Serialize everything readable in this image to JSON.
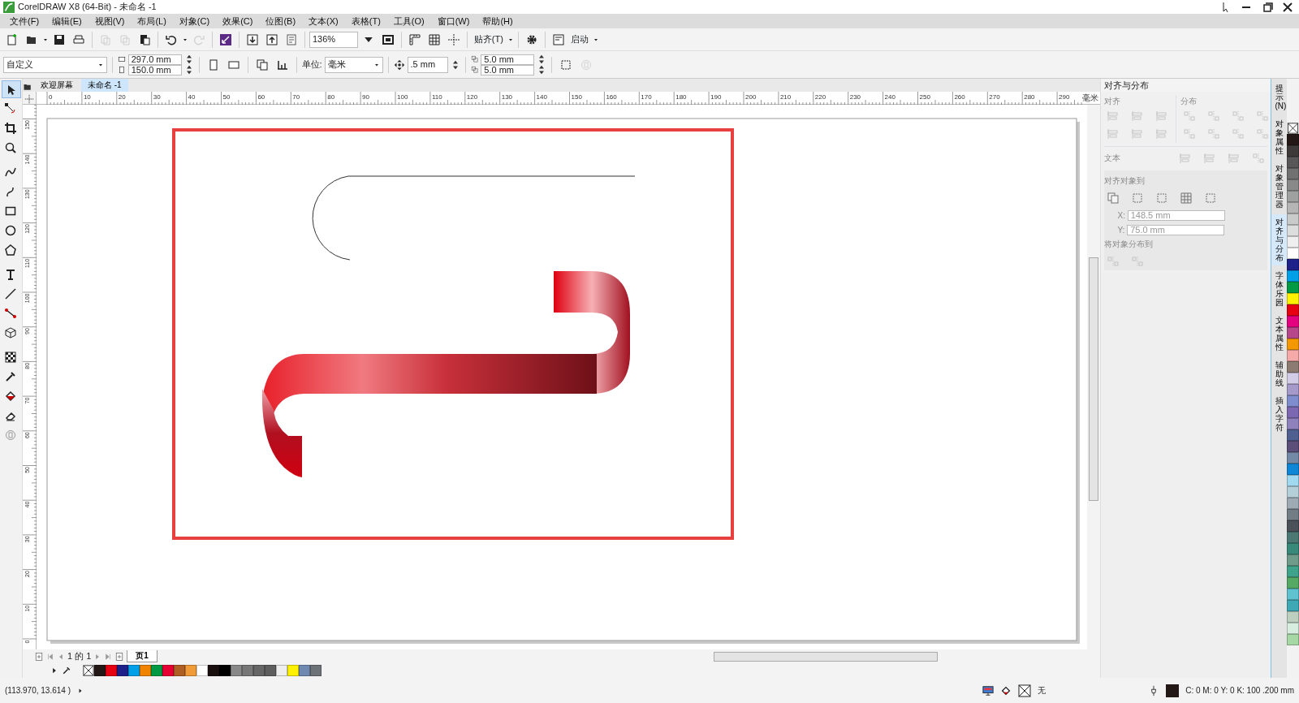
{
  "window": {
    "title": "CorelDRAW X8 (64-Bit) - 未命名 -1"
  },
  "menu": [
    "文件(F)",
    "编辑(E)",
    "视图(V)",
    "布局(L)",
    "对象(C)",
    "效果(C)",
    "位图(B)",
    "文本(X)",
    "表格(T)",
    "工具(O)",
    "窗口(W)",
    "帮助(H)"
  ],
  "standard_toolbar": {
    "buttons": [
      {
        "disabled": false
      },
      {
        "disabled": false
      },
      {
        "disabled": false
      },
      {
        "disabled": false
      },
      {
        "disabled": true
      },
      {
        "disabled": true
      },
      {
        "disabled": false
      },
      {
        "disabled": false
      },
      {
        "disabled": true
      },
      {
        "disabled": false
      },
      {
        "disabled": false
      },
      {
        "disabled": false
      },
      {
        "disabled": false
      }
    ],
    "zoom": "136%",
    "snap_label": "贴齐(T)",
    "launch_label": "启动"
  },
  "property_bar": {
    "preset": "自定义",
    "width": "297.0 mm",
    "height": "150.0 mm",
    "units_label": "单位:",
    "units": "毫米",
    "nudge": ".5 mm",
    "dup_x": "5.0 mm",
    "dup_y": "5.0 mm"
  },
  "toolbox": [
    {
      "selected": true
    },
    {
      "selected": false
    },
    {
      "selected": false
    },
    {
      "selected": false
    },
    {
      "selected": false
    },
    {
      "selected": false
    },
    {
      "selected": false
    },
    {
      "selected": false
    },
    {
      "selected": false
    },
    {
      "selected": false
    },
    {
      "selected": false
    },
    {
      "selected": false
    },
    {
      "selected": false
    },
    {
      "selected": false
    },
    {
      "selected": false
    },
    {
      "selected": false
    },
    {
      "selected": false
    },
    {
      "selected": false
    }
  ],
  "doc_tabs": [
    {
      "label": "欢迎屏幕",
      "selected": false
    },
    {
      "label": "未命名 -1",
      "selected": true
    }
  ],
  "top_ruler": [
    "0",
    "10",
    "20",
    "30",
    "40",
    "50",
    "60",
    "70",
    "80",
    "90",
    "100",
    "110",
    "120",
    "130",
    "140",
    "150",
    "160",
    "170",
    "180",
    "190",
    "200",
    "210",
    "220",
    "230",
    "240",
    "250",
    "260",
    "270",
    "280",
    "290"
  ],
  "ruler_unit": "毫米",
  "left_ruler": [
    "150",
    "140",
    "130",
    "120",
    "110",
    "100",
    "90",
    "80",
    "70",
    "60",
    "50",
    "40",
    "30",
    "20",
    "10",
    "0"
  ],
  "docker": {
    "title": "对齐与分布",
    "align_label": "对齐",
    "distribute_label": "分布",
    "text_label": "文本",
    "align_to_label": "对齐对象到",
    "x_label": "X:",
    "x": "148.5 mm",
    "y_label": "Y:",
    "y": "75.0 mm",
    "distribute_to_label": "将对象分布到"
  },
  "docker_tabs": [
    {
      "label": "提示(N)",
      "selected": false
    },
    {
      "label": "对象属性",
      "selected": false
    },
    {
      "label": "对象管理器",
      "selected": false
    },
    {
      "label": "对齐与分布",
      "selected": true
    },
    {
      "label": "字体乐园",
      "selected": false
    },
    {
      "label": "文本属性",
      "selected": false
    },
    {
      "label": "辅助线",
      "selected": false
    },
    {
      "label": "插入字符",
      "selected": false
    }
  ],
  "page_nav": {
    "counter": "1 的 1",
    "page_tabs": [
      {
        "label": "页1",
        "selected": true
      }
    ]
  },
  "bottom_palette": [
    {
      "color": "#231815"
    },
    {
      "color": "#e60012"
    },
    {
      "color": "#1d2088"
    },
    {
      "color": "#00a0e9"
    },
    {
      "color": "#f08300"
    },
    {
      "color": "#009944"
    },
    {
      "color": "#e60033"
    },
    {
      "color": "#b05f24"
    },
    {
      "color": "#f19a38"
    },
    {
      "color": "#ffffff"
    },
    {
      "color": "#1a0f0f"
    },
    {
      "color": "#000000"
    },
    {
      "color": "#888888"
    },
    {
      "color": "#777777"
    },
    {
      "color": "#666666"
    },
    {
      "color": "#5e5e5e"
    },
    {
      "color": "#eeeeee"
    },
    {
      "color": "#fff100"
    },
    {
      "color": "#7089b0"
    },
    {
      "color": "#6d7278"
    }
  ],
  "side_palette": [
    {
      "color": "#231815"
    },
    {
      "color": "#3e3a39"
    },
    {
      "color": "#595757"
    },
    {
      "color": "#727171"
    },
    {
      "color": "#898989"
    },
    {
      "color": "#9fa0a0"
    },
    {
      "color": "#b5b5b6"
    },
    {
      "color": "#c9caca"
    },
    {
      "color": "#dcdddd"
    },
    {
      "color": "#efefef"
    },
    {
      "color": "#ffffff"
    },
    {
      "color": "#1d2088"
    },
    {
      "color": "#00a0e9"
    },
    {
      "color": "#009944"
    },
    {
      "color": "#fff100"
    },
    {
      "color": "#e60012"
    },
    {
      "color": "#e4007f"
    },
    {
      "color": "#b5478a"
    },
    {
      "color": "#f39800"
    },
    {
      "color": "#f5a9a9"
    },
    {
      "color": "#8c7b70"
    },
    {
      "color": "#d3cce6"
    },
    {
      "color": "#a59aca"
    },
    {
      "color": "#7f8ccd"
    },
    {
      "color": "#7b68b0"
    },
    {
      "color": "#8f82bc"
    },
    {
      "color": "#4f5f8f"
    },
    {
      "color": "#5b4f7a"
    },
    {
      "color": "#7489a5"
    },
    {
      "color": "#0e87d6"
    },
    {
      "color": "#a0d8ef"
    },
    {
      "color": "#b4cfd8"
    },
    {
      "color": "#9eaab4"
    },
    {
      "color": "#727c85"
    },
    {
      "color": "#4a5159"
    },
    {
      "color": "#4c7873"
    },
    {
      "color": "#39897a"
    },
    {
      "color": "#6e9b8a"
    },
    {
      "color": "#3ea38a"
    },
    {
      "color": "#56a964"
    },
    {
      "color": "#5ec2cf"
    },
    {
      "color": "#3ea8b5"
    },
    {
      "color": "#bdd0c0"
    },
    {
      "color": "#d7ede0"
    },
    {
      "color": "#a5d8a5"
    }
  ],
  "status_bar": {
    "coords": "(113.970, 13.614 )",
    "fill": "无",
    "outline": "C: 0 M: 0 Y: 0 K: 100 .200 mm"
  }
}
